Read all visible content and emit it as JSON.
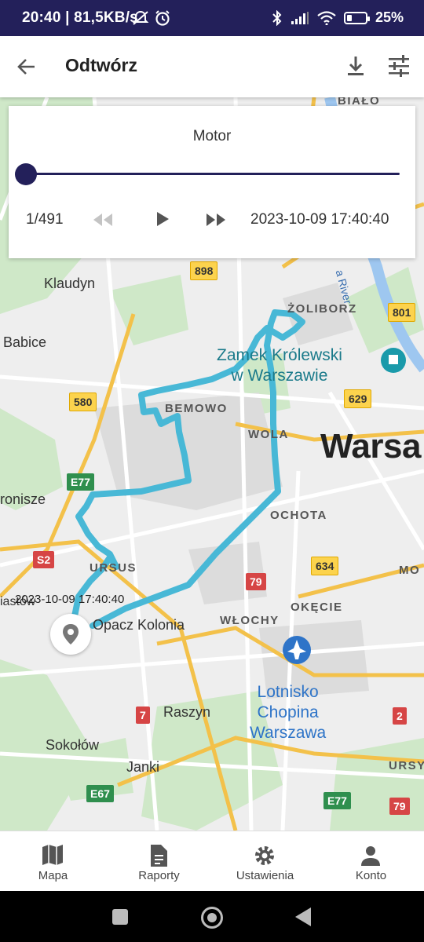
{
  "status_bar": {
    "left_text": "20:40 | 81,5KB/s",
    "battery": "25%",
    "battery_level": 0.25,
    "icons": [
      "mute-alarm-icon",
      "alarm-clock-icon",
      "bluetooth-icon",
      "signal-icon",
      "wifi-icon",
      "battery-icon"
    ]
  },
  "app_bar": {
    "title": "Odtwórz",
    "icons": [
      "back-arrow-icon",
      "download-icon",
      "tune-icon"
    ]
  },
  "player": {
    "vehicle": "Motor",
    "position_label": "1/491",
    "progress": 0.0,
    "timestamp": "2023-10-09 17:40:40",
    "accent": "#23205a",
    "icons": [
      "rewind-icon",
      "play-icon",
      "fast-forward-icon"
    ]
  },
  "map": {
    "route_color": "#48b8d6",
    "marker_label": "2023-10-09 17:40:40",
    "labels": {
      "klaudyn": "Klaudyn",
      "babice": "Babice",
      "bemowo": "BEMOWO",
      "zoliborz": "ŻOLIBORZ",
      "wola": "WOLA",
      "ochota": "OCHOTA",
      "ursus": "URSUS",
      "okecie": "OKĘCIE",
      "wlochy": "WŁOCHY",
      "opacz": "Opacz Kolonia",
      "raszyn": "Raszyn",
      "sokolow": "Sokołów",
      "janki": "Janki",
      "bialo": "BIAŁO",
      "ronisze": "ronisze",
      "iastow": "iastów",
      "warsa": "Warsa",
      "mo": "MO",
      "ursy": "URSY",
      "wisla": "a River",
      "zamek": "Zamek Królewski\nw Warszawie",
      "lotnisko": "Lotnisko\nChopina\nWarszawa"
    },
    "shields": {
      "s898": "898",
      "s801": "801",
      "s580": "580",
      "s629": "629",
      "s634": "634",
      "e77a": "E77",
      "e77b": "E77",
      "e67": "E67",
      "s2": "S2",
      "r79a": "79",
      "r79b": "79",
      "r7": "7",
      "r2": "2"
    }
  },
  "bottom_nav": [
    {
      "label": "Mapa",
      "icon": "map-icon"
    },
    {
      "label": "Raporty",
      "icon": "report-icon"
    },
    {
      "label": "Ustawienia",
      "icon": "settings-icon"
    },
    {
      "label": "Konto",
      "icon": "account-icon"
    }
  ]
}
